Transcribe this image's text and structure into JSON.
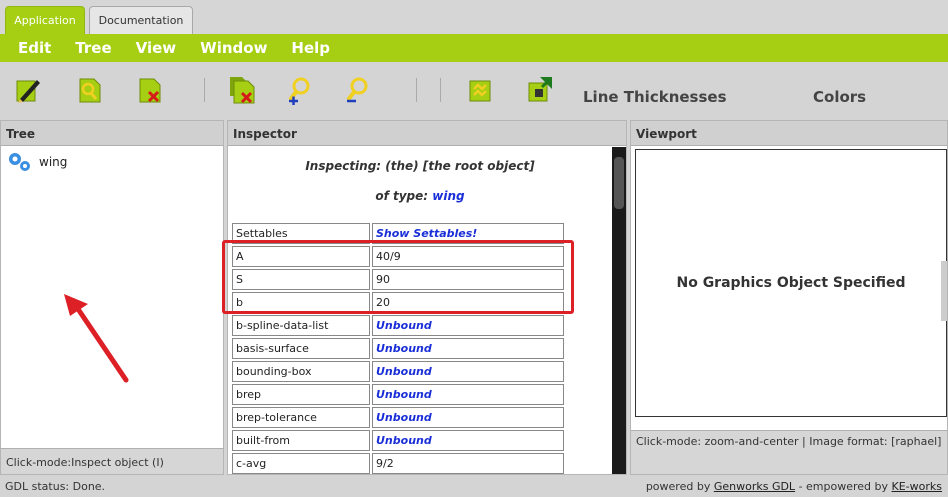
{
  "tabs": [
    {
      "label": "Application",
      "active": true
    },
    {
      "label": "Documentation",
      "active": false
    }
  ],
  "menu": [
    "Edit",
    "Tree",
    "View",
    "Window",
    "Help"
  ],
  "toolbar": {
    "icons": [
      "edit-icon",
      "inspect-icon",
      "delete-icon",
      "delete-leaves-icon",
      "zoom-in-icon",
      "zoom-out-icon",
      "refresh-icon",
      "update-icon"
    ],
    "line_thicknesses": "Line Thicknesses",
    "colors": "Colors"
  },
  "tree": {
    "header": "Tree",
    "root_node": "wing",
    "footer": "Click-mode:Inspect object (I)"
  },
  "inspector": {
    "header": "Inspector",
    "line1_prefix": "Inspecting: (the) [the root object]",
    "line2_prefix": "of type:",
    "type_name": "wing",
    "rows": [
      {
        "key": "Settables",
        "value": "Show Settables!",
        "link": true
      },
      {
        "key": "A",
        "value": "40/9",
        "link": false
      },
      {
        "key": "S",
        "value": "90",
        "link": false
      },
      {
        "key": "b",
        "value": "20",
        "link": false
      },
      {
        "key": "b-spline-data-list",
        "value": "Unbound",
        "link": true
      },
      {
        "key": "basis-surface",
        "value": "Unbound",
        "link": true
      },
      {
        "key": "bounding-box",
        "value": "Unbound",
        "link": true
      },
      {
        "key": "brep",
        "value": "Unbound",
        "link": true
      },
      {
        "key": "brep-tolerance",
        "value": "Unbound",
        "link": true
      },
      {
        "key": "built-from",
        "value": "Unbound",
        "link": true
      },
      {
        "key": "c-avg",
        "value": "9/2",
        "link": false
      }
    ]
  },
  "viewport": {
    "header": "Viewport",
    "message": "No Graphics Object Specified",
    "footer": "Click-mode: zoom-and-center | Image format: [raphael]"
  },
  "status": {
    "left": "GDL status: Done.",
    "powered_by": "powered by",
    "genworks": "Genworks GDL",
    "empowered": "- empowered by",
    "keworks": "KE-works"
  },
  "colors": {
    "accent": "#a6ce13",
    "highlight": "#dd1f26",
    "link": "#1a2fd8"
  }
}
